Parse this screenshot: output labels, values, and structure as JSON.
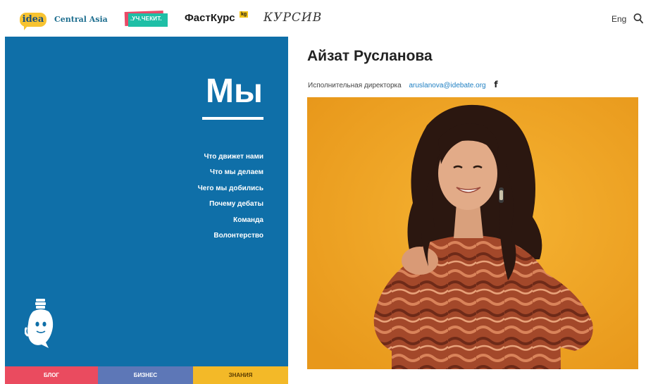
{
  "header": {
    "logo_idea": "idea",
    "logo_central_asia": "Central Asia",
    "logo_factcheck": ".УЧ.ЧЕКИТ.",
    "logo_fastkurs": "ФастКурс",
    "logo_fastkurs_badge": "kg",
    "logo_kursiv": "КУРСИВ",
    "language": "Eng",
    "search_icon": "search-icon"
  },
  "panel": {
    "title": "Мы",
    "nav": [
      {
        "label": "Что движет нами"
      },
      {
        "label": "Что мы делаем"
      },
      {
        "label": "Чего мы добились"
      },
      {
        "label": "Почему дебаты"
      },
      {
        "label": "Команда"
      },
      {
        "label": "Волонтерство"
      }
    ],
    "mascot_icon": "lightbulb-mascot-icon"
  },
  "bottom_tabs": [
    {
      "label": "БЛОГ",
      "color": "#ea4b5f"
    },
    {
      "label": "БИЗНЕС",
      "color": "#5d77b7"
    },
    {
      "label": "ЗНАНИЯ",
      "color": "#f3b928"
    }
  ],
  "profile": {
    "name": "Айзат Русланова",
    "role": "Исполнительная директорка",
    "email": "aruslanova@idebate.org",
    "social_icon": "facebook-icon",
    "photo_bg": "#f0a423"
  },
  "colors": {
    "panel_blue": "#0f6fa8",
    "link_blue": "#1e7fc2"
  }
}
